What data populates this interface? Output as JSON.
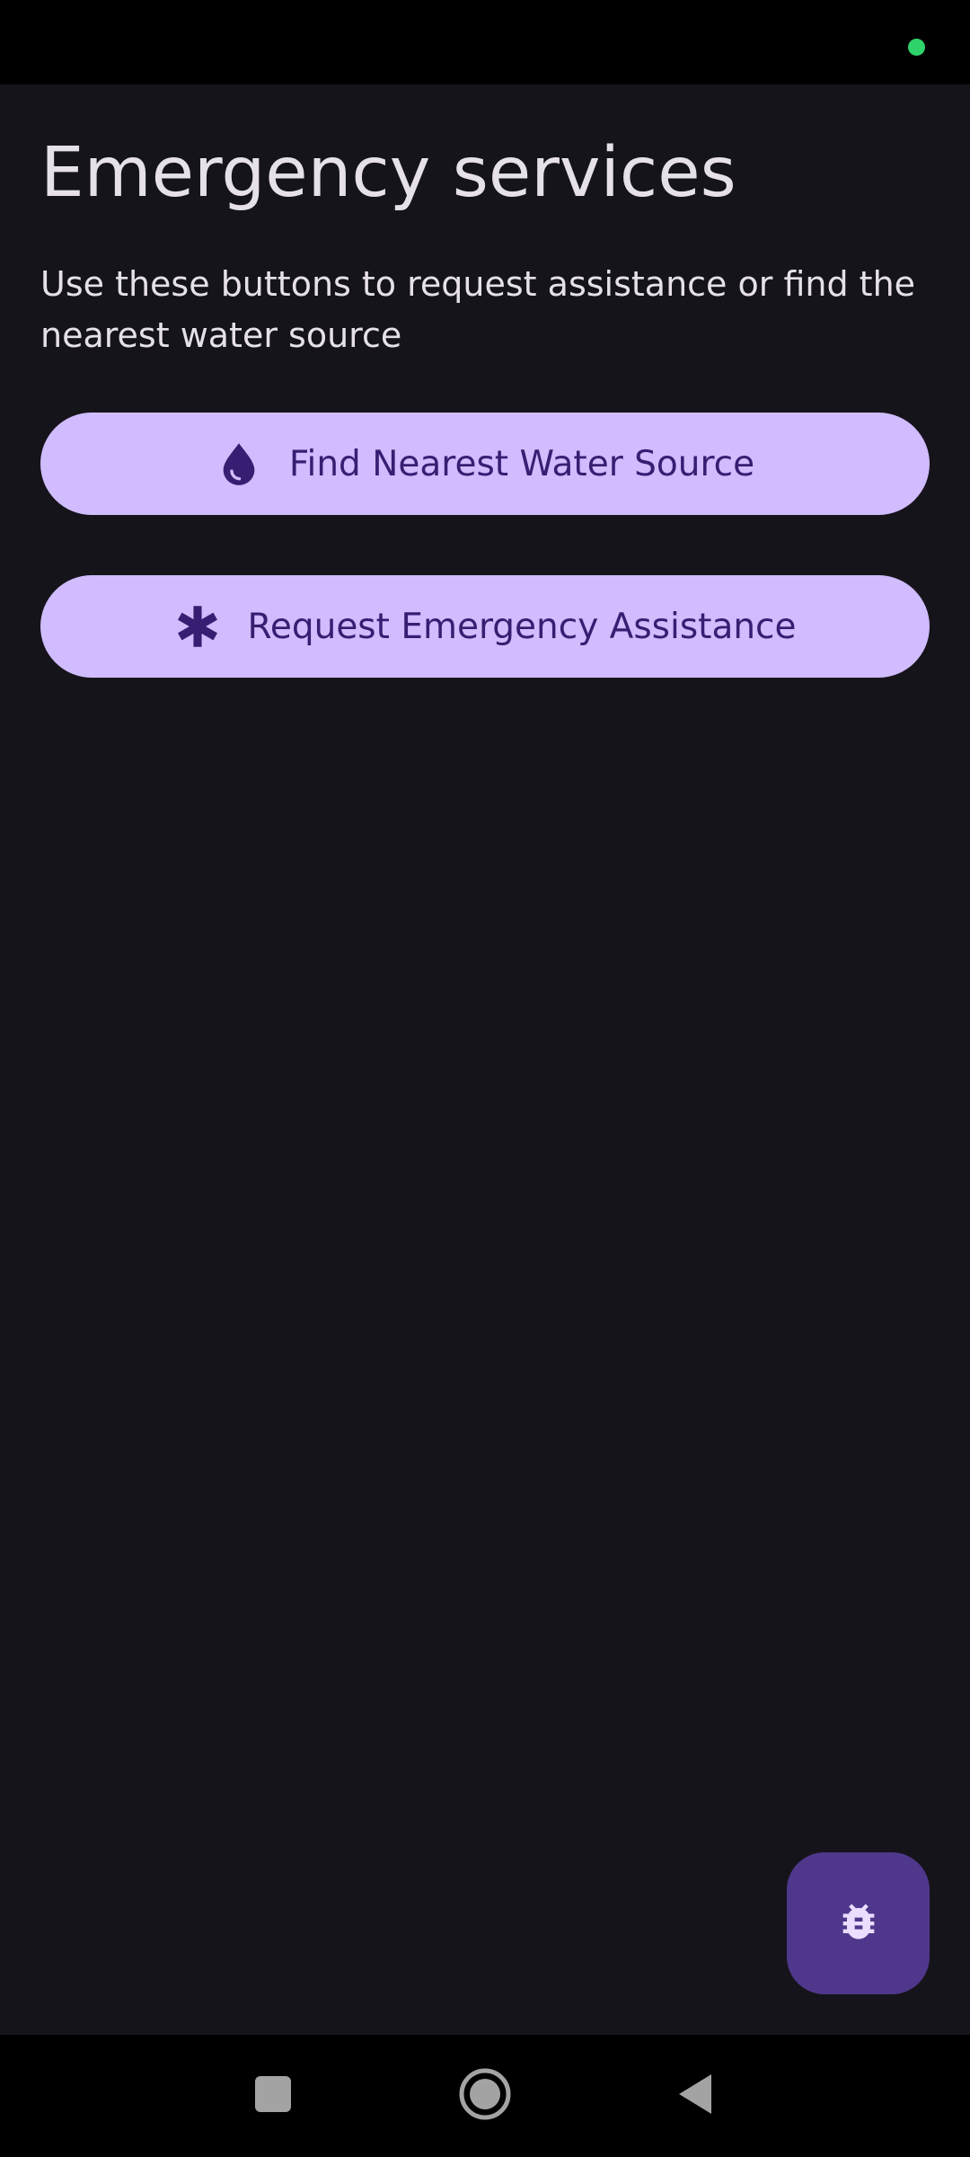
{
  "colors": {
    "background": "#16141b",
    "bars": "#000000",
    "on_background": "#e6e1e8",
    "button_container": "#d0bcfe",
    "on_button_container": "#381e72",
    "fab_container": "#4f378b",
    "fab_icon": "#eaddff",
    "privacy_dot": "#2fd36b",
    "nav_icon": "#a3a3a3"
  },
  "page": {
    "title": "Emergency services",
    "description": "Use these buttons to request assistance or find the nearest water source"
  },
  "buttons": {
    "water": {
      "label": "Find Nearest Water Source",
      "icon": "water-drop-icon"
    },
    "emergency": {
      "label": "Request Emergency Assistance",
      "icon": "asterisk-icon"
    }
  },
  "fab": {
    "icon": "bug-icon"
  },
  "navigation": {
    "recents_icon": "square-icon",
    "home_icon": "circle-icon",
    "back_icon": "triangle-back-icon"
  }
}
